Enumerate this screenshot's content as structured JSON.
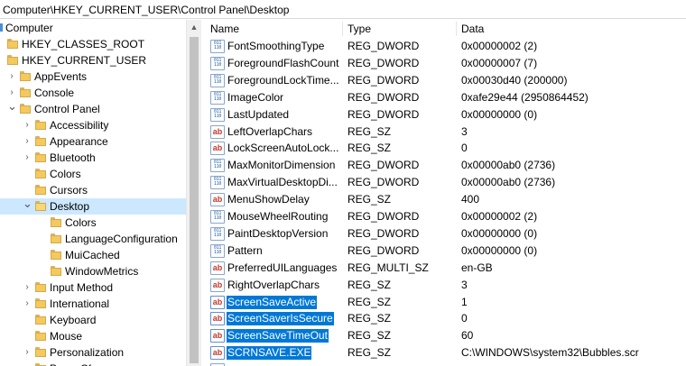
{
  "address": "Computer\\HKEY_CURRENT_USER\\Control Panel\\Desktop",
  "tree": {
    "nodes": [
      {
        "label": "Computer",
        "indent": 0,
        "twisty": "",
        "icon": "computer"
      },
      {
        "label": "HKEY_CLASSES_ROOT",
        "indent": 0,
        "twisty": "",
        "icon": "folder"
      },
      {
        "label": "HKEY_CURRENT_USER",
        "indent": 0,
        "twisty": "",
        "icon": "folder"
      },
      {
        "label": "AppEvents",
        "indent": 1,
        "twisty": "collapsed",
        "icon": "folder"
      },
      {
        "label": "Console",
        "indent": 1,
        "twisty": "collapsed",
        "icon": "folder"
      },
      {
        "label": "Control Panel",
        "indent": 1,
        "twisty": "expanded",
        "icon": "folder"
      },
      {
        "label": "Accessibility",
        "indent": 2,
        "twisty": "collapsed",
        "icon": "folder"
      },
      {
        "label": "Appearance",
        "indent": 2,
        "twisty": "collapsed",
        "icon": "folder"
      },
      {
        "label": "Bluetooth",
        "indent": 2,
        "twisty": "collapsed",
        "icon": "folder"
      },
      {
        "label": "Colors",
        "indent": 2,
        "twisty": "",
        "icon": "folder"
      },
      {
        "label": "Cursors",
        "indent": 2,
        "twisty": "",
        "icon": "folder"
      },
      {
        "label": "Desktop",
        "indent": 2,
        "twisty": "expanded",
        "icon": "folder-open",
        "selected": true
      },
      {
        "label": "Colors",
        "indent": 3,
        "twisty": "",
        "icon": "folder"
      },
      {
        "label": "LanguageConfiguration",
        "indent": 3,
        "twisty": "",
        "icon": "folder"
      },
      {
        "label": "MuiCached",
        "indent": 3,
        "twisty": "",
        "icon": "folder"
      },
      {
        "label": "WindowMetrics",
        "indent": 3,
        "twisty": "",
        "icon": "folder"
      },
      {
        "label": "Input Method",
        "indent": 2,
        "twisty": "collapsed",
        "icon": "folder"
      },
      {
        "label": "International",
        "indent": 2,
        "twisty": "collapsed",
        "icon": "folder"
      },
      {
        "label": "Keyboard",
        "indent": 2,
        "twisty": "",
        "icon": "folder"
      },
      {
        "label": "Mouse",
        "indent": 2,
        "twisty": "",
        "icon": "folder"
      },
      {
        "label": "Personalization",
        "indent": 2,
        "twisty": "collapsed",
        "icon": "folder"
      },
      {
        "label": "PowerCfg",
        "indent": 2,
        "twisty": "collapsed",
        "icon": "folder"
      }
    ]
  },
  "list": {
    "columns": {
      "name": "Name",
      "type": "Type",
      "data": "Data"
    },
    "rows": [
      {
        "name": "FontSmoothingType",
        "type": "REG_DWORD",
        "data": "0x00000002 (2)",
        "icon": "dword"
      },
      {
        "name": "ForegroundFlashCount",
        "type": "REG_DWORD",
        "data": "0x00000007 (7)",
        "icon": "dword"
      },
      {
        "name": "ForegroundLockTime...",
        "type": "REG_DWORD",
        "data": "0x00030d40 (200000)",
        "icon": "dword"
      },
      {
        "name": "ImageColor",
        "type": "REG_DWORD",
        "data": "0xafe29e44 (2950864452)",
        "icon": "dword"
      },
      {
        "name": "LastUpdated",
        "type": "REG_DWORD",
        "data": "0x00000000 (0)",
        "icon": "dword"
      },
      {
        "name": "LeftOverlapChars",
        "type": "REG_SZ",
        "data": "3",
        "icon": "sz"
      },
      {
        "name": "LockScreenAutoLock...",
        "type": "REG_SZ",
        "data": "0",
        "icon": "sz"
      },
      {
        "name": "MaxMonitorDimension",
        "type": "REG_DWORD",
        "data": "0x00000ab0 (2736)",
        "icon": "dword"
      },
      {
        "name": "MaxVirtualDesktopDi...",
        "type": "REG_DWORD",
        "data": "0x00000ab0 (2736)",
        "icon": "dword"
      },
      {
        "name": "MenuShowDelay",
        "type": "REG_SZ",
        "data": "400",
        "icon": "sz"
      },
      {
        "name": "MouseWheelRouting",
        "type": "REG_DWORD",
        "data": "0x00000002 (2)",
        "icon": "dword"
      },
      {
        "name": "PaintDesktopVersion",
        "type": "REG_DWORD",
        "data": "0x00000000 (0)",
        "icon": "dword"
      },
      {
        "name": "Pattern",
        "type": "REG_DWORD",
        "data": "0x00000000 (0)",
        "icon": "dword"
      },
      {
        "name": "PreferredUILanguages",
        "type": "REG_MULTI_SZ",
        "data": "en-GB",
        "icon": "sz"
      },
      {
        "name": "RightOverlapChars",
        "type": "REG_SZ",
        "data": "3",
        "icon": "sz"
      },
      {
        "name": "ScreenSaveActive",
        "type": "REG_SZ",
        "data": "1",
        "icon": "sz",
        "selected": true
      },
      {
        "name": "ScreenSaverIsSecure",
        "type": "REG_SZ",
        "data": "0",
        "icon": "sz",
        "selected": true
      },
      {
        "name": "ScreenSaveTimeOut",
        "type": "REG_SZ",
        "data": "60",
        "icon": "sz",
        "selected": true
      },
      {
        "name": "SCRNSAVE.EXE",
        "type": "REG_SZ",
        "data": "C:\\WINDOWS\\system32\\Bubbles.scr",
        "icon": "sz",
        "selected": true
      },
      {
        "name": "",
        "type": "",
        "data": "",
        "icon": "sz"
      }
    ]
  },
  "icons": {
    "dword_glyph": "011\n110",
    "sz_glyph": "ab"
  },
  "colors": {
    "selection": "#0078d7",
    "tree_selection": "#cce8ff"
  }
}
